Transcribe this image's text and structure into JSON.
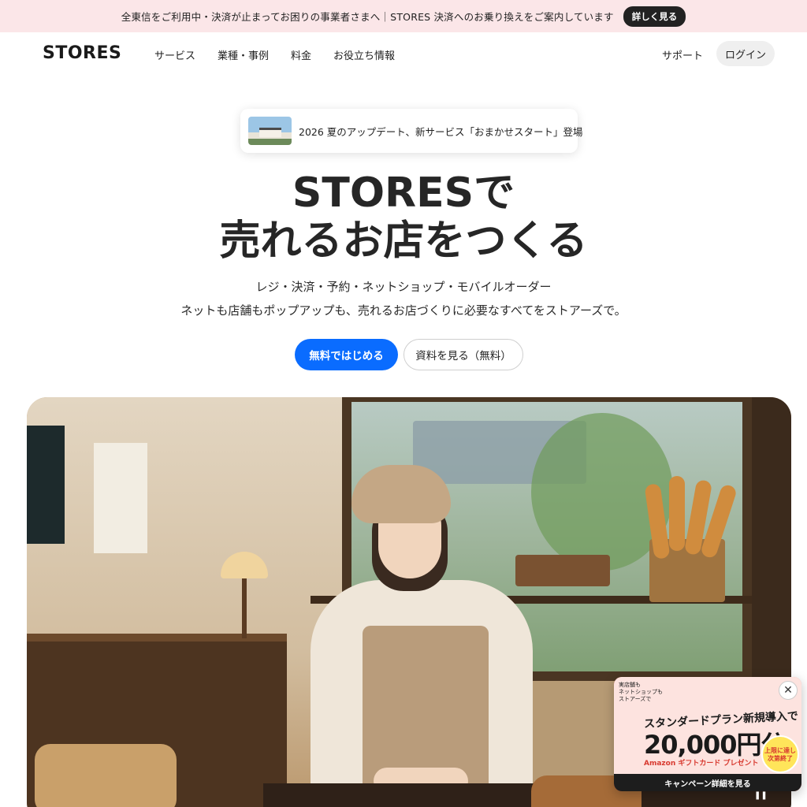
{
  "announcement": {
    "text": "全東信をご利用中・決済が止まってお困りの事業者さまへ｜STORES 決済へのお乗り換えをご案内しています",
    "button": "詳しく見る"
  },
  "header": {
    "logo": "STORES",
    "nav": [
      "サービス",
      "業種・事例",
      "料金",
      "お役立ち情報"
    ],
    "support": "サポート",
    "login": "ログイン"
  },
  "news": {
    "text": "2026 夏のアップデート、新サービス「おまかせスタート」登場"
  },
  "hero": {
    "title_line1": "STORESで",
    "title_line2": "売れるお店をつくる",
    "subtitle1": "レジ・決済・予約・ネットショップ・モバイルオーダー",
    "subtitle2": "ネットも店舗もポップアップも、売れるお店づくりに必要なすべてをストアーズで。",
    "cta_primary": "無料ではじめる",
    "cta_secondary": "資料を見る（無料）"
  },
  "promo": {
    "small": "実店舗も\nネットショップも\nストアーズで",
    "plan": "スタンダードプラン新規導入で",
    "amount": "20,000円分",
    "gift": "Amazon ギフトカード プレゼント",
    "badge": "上限に達し\n次第終了",
    "footer": "キャンペーン詳細を見る",
    "close": "✕"
  },
  "colors": {
    "accent": "#0a6cff",
    "announce_bg": "#fbe6e8",
    "promo_red": "#ff6b67"
  }
}
